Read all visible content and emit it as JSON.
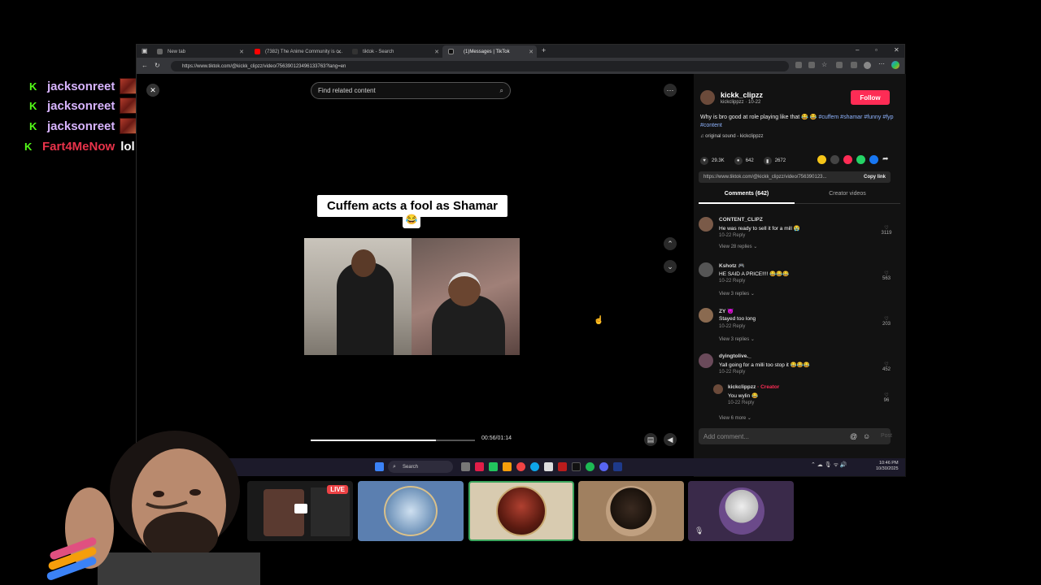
{
  "chat": [
    {
      "user": "jacksonreet",
      "message": "",
      "color": "#d8b4fe"
    },
    {
      "user": "jacksonreet",
      "message": "",
      "color": "#d8b4fe"
    },
    {
      "user": "jacksonreet",
      "message": "",
      "color": "#d8b4fe"
    },
    {
      "user": "Fart4MeNow",
      "message": "lol",
      "color": "#e8334a"
    }
  ],
  "browser": {
    "tabs": [
      "New tab",
      "(7382) The Anime Community is c...",
      "tiktok - Search",
      "(1)Messages | TikTok"
    ],
    "url": "https://www.tiktok.com/@kickk_clipzz/video/756390123496133763?lang=en"
  },
  "video": {
    "search_placeholder": "Find related content",
    "caption": "Cuffem acts a fool as Shamar",
    "caption_emoji": "😂",
    "time": "00:56/01:14",
    "progress": 0.76
  },
  "panel": {
    "username": "kickk_clipzz",
    "subline": "kickclippzz · 10-22",
    "follow_label": "Follow",
    "description": "Why is bro good at role playing like that 😂 😂",
    "tags": "#cuffem #shamar #funny #fyp #content",
    "sound": "original sound - kickclippzz",
    "likes": "29.3K",
    "comments_count": "642",
    "saves": "2672",
    "link": "https://www.tiktok.com/@kickk_clipzz/video/756390123...",
    "copy_link": "Copy link",
    "tab_comments": "Comments (642)",
    "tab_videos": "Creator videos",
    "comments": [
      {
        "user": "CONTENT_CLIPZ",
        "text": "He was ready to sell it for a mill 😭",
        "meta": "10-22    Reply",
        "likes": "3119",
        "view": "View 28 replies ⌄"
      },
      {
        "user": "Kshotz 🎮",
        "text": "HE SAID A PRICE!!!! 😂😂😂",
        "meta": "10-22    Reply",
        "likes": "563",
        "view": "View 3 replies ⌄"
      },
      {
        "user": "ZY 😈",
        "text": "Stayed too long",
        "meta": "10-22    Reply",
        "likes": "203",
        "view": "View 3 replies ⌄"
      },
      {
        "user": "dyingtolive._",
        "text": "Yall going for a milli too stop it 😂😂😂",
        "meta": "10-22    Reply",
        "likes": "452",
        "view": ""
      }
    ],
    "reply": {
      "user": "kickclippzz",
      "badge": "· Creator",
      "text": "You wylin 😂",
      "meta": "10-22    Reply",
      "likes": "96"
    },
    "view_more": "View 6 more ⌄",
    "add_comment": "Add comment...",
    "post": "Post"
  },
  "taskbar": {
    "search": "Search",
    "time": "10:46 PM",
    "date": "10/30/2025"
  },
  "discord": {
    "live_label": "LIVE"
  }
}
